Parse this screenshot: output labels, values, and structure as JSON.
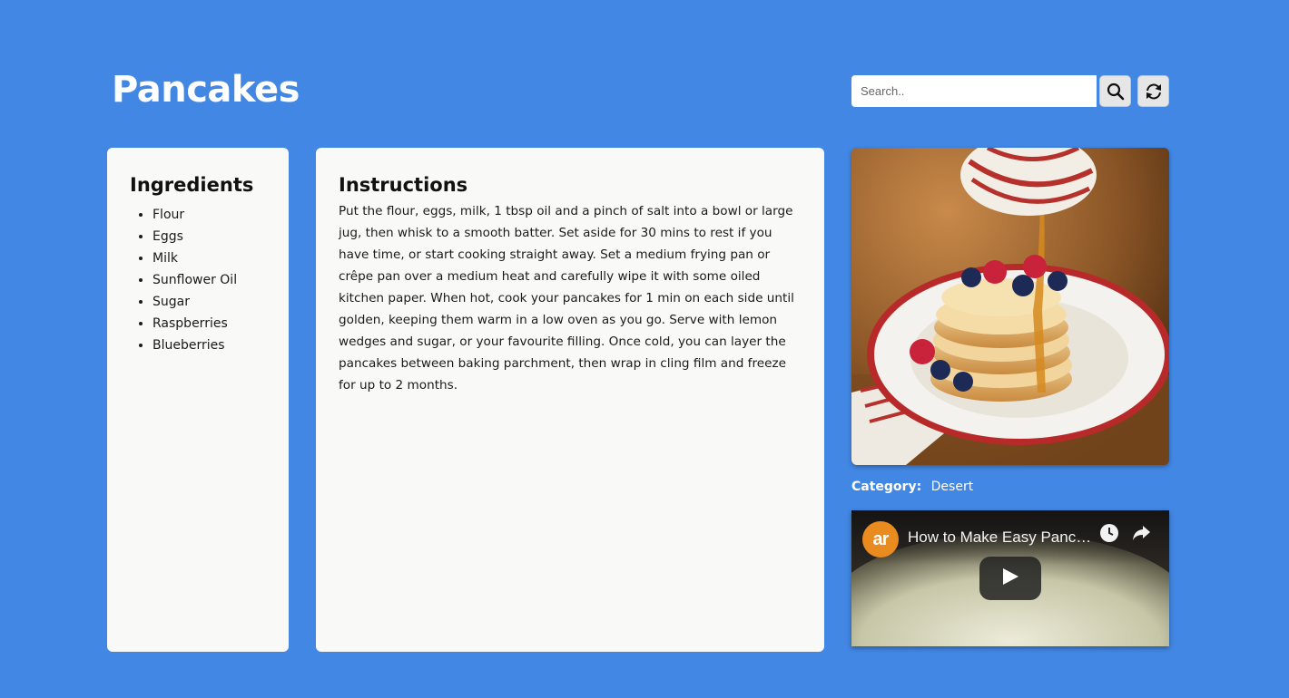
{
  "header": {
    "title": "Pancakes",
    "search_placeholder": "Search..",
    "search_value": ""
  },
  "icons": {
    "search": "search-icon",
    "random": "refresh-icon"
  },
  "ingredients": {
    "heading": "Ingredients",
    "items": [
      "Flour",
      "Eggs",
      "Milk",
      "Sunflower Oil",
      "Sugar",
      "Raspberries",
      "Blueberries"
    ]
  },
  "instructions": {
    "heading": "Instructions",
    "text": "Put the flour, eggs, milk, 1 tbsp oil and a pinch of salt into a bowl or large jug, then whisk to a smooth batter. Set aside for 30 mins to rest if you have time, or start cooking straight away. Set a medium frying pan or crêpe pan over a medium heat and carefully wipe it with some oiled kitchen paper. When hot, cook your pancakes for 1 min on each side until golden, keeping them warm in a low oven as you go. Serve with lemon wedges and sugar, or your favourite filling. Once cold, you can layer the pancakes between baking parchment, then wrap in cling film and freeze for up to 2 months."
  },
  "meal": {
    "category_label": "Category:",
    "category_value": "Desert"
  },
  "video": {
    "title": "How to Make Easy Pancakes",
    "channel_logo_text": "ar"
  },
  "colors": {
    "page_background": "#4187e3",
    "panel_background": "#f9f9f7",
    "title_text": "#ffffff"
  }
}
